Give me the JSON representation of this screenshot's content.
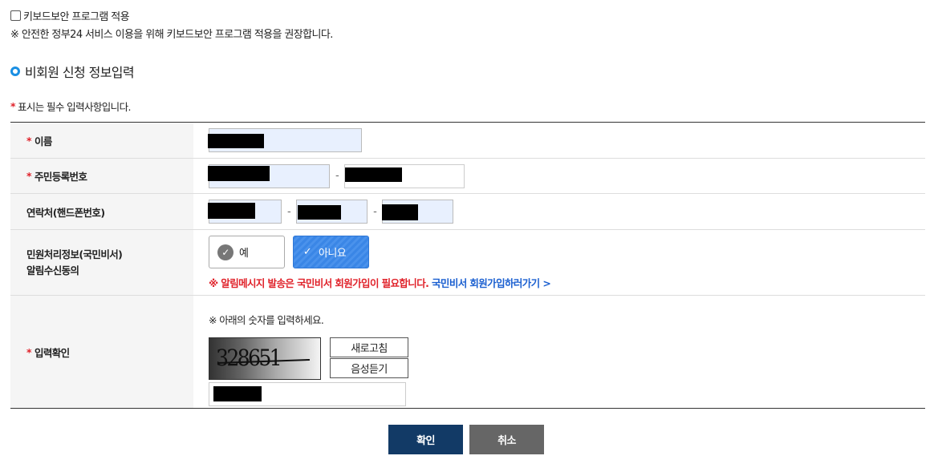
{
  "keyboard_security": {
    "checkbox_label": "키보드보안 프로그램 적용",
    "notice": "※ 안전한 정부24 서비스 이용을 위해 키보드보안 프로그램 적용을 권장합니다.",
    "checked": false
  },
  "section": {
    "title": "비회원 신청 정보입력"
  },
  "required_notice": {
    "star": "*",
    "text": "표시는 필수 입력사항입니다."
  },
  "form": {
    "name": {
      "label": "이름",
      "required": true
    },
    "resident_number": {
      "label": "주민등록번호",
      "required": true,
      "separator": "-"
    },
    "phone": {
      "label": "연락처(핸드폰번호)",
      "required": false,
      "separator": "-"
    },
    "notification": {
      "label_line1": "민원처리정보(국민비서)",
      "label_line2": "알림수신동의",
      "yes_label": "예",
      "no_label": "아니요",
      "selected": "아니요",
      "alert_text": "※ 알림메시지 발송은 국민비서 회원가입이 필요합니다.",
      "link_text": "국민비서 회원가입하러가기 >"
    },
    "captcha": {
      "label": "입력확인",
      "required": true,
      "instruction": "※ 아래의 숫자를 입력하세요.",
      "image_text": "328651",
      "refresh_label": "새로고침",
      "audio_label": "음성듣기"
    }
  },
  "buttons": {
    "confirm": "확인",
    "cancel": "취소"
  },
  "colors": {
    "accent_blue": "#1a8fe3",
    "required_red": "#e0222a",
    "primary_button": "#123a66",
    "secondary_button": "#666666",
    "selected_option": "#3a86e6"
  }
}
